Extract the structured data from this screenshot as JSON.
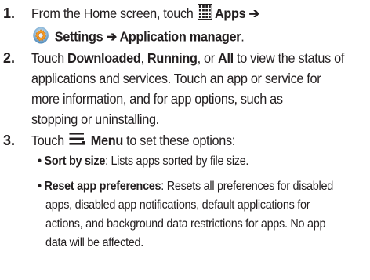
{
  "steps": [
    {
      "number": "1.",
      "line1_text": "From the Home screen, touch ",
      "apps_label": "Apps",
      "arrow": "➔",
      "settings_label": "Settings",
      "arrow2": " ➔ ",
      "app_manager_label": "Application manager",
      "period": ".",
      "icons": [
        "apps-grid-icon",
        "settings-gear-icon"
      ]
    },
    {
      "number": "2.",
      "touch": "Touch ",
      "downloaded": "Downloaded",
      "comma1": ", ",
      "running": "Running",
      "or": ", or ",
      "all": "All",
      "rest1": " to view the status of",
      "line2": "applications and services. Touch an app or service for",
      "line3": "more information, and for app options, such as",
      "line4": "stopping or uninstalling."
    },
    {
      "number": "3.",
      "touch": "Touch ",
      "menu_label": "Menu",
      "rest": " to set these options:",
      "icon": "menu-icon",
      "options": [
        {
          "bullet": "•",
          "name": "Sort by size",
          "desc": ": Lists apps sorted by file size."
        },
        {
          "bullet": "•",
          "name": "Reset app preferences",
          "desc": ": Resets all preferences for disabled",
          "lines": [
            "apps, disabled app notifications, default applications for",
            "actions, and background data restrictions for apps. No app",
            "data will be affected."
          ]
        }
      ]
    }
  ]
}
